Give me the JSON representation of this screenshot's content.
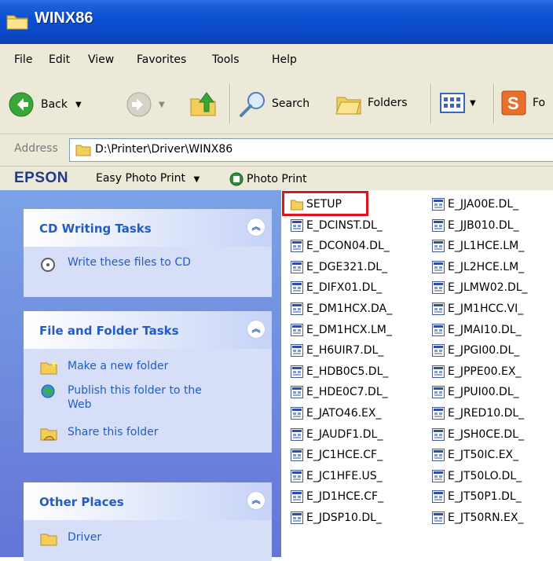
{
  "window": {
    "title": "WINX86"
  },
  "menu": [
    "File",
    "Edit",
    "View",
    "Favorites",
    "Tools",
    "Help"
  ],
  "toolbar": {
    "back_label": "Back",
    "search_label": "Search",
    "folders_label": "Folders",
    "fo_label": "Fo"
  },
  "address": {
    "label": "Address",
    "path": "D:\\Printer\\Driver\\WINX86"
  },
  "epson": {
    "brand": "EPSON",
    "easy_photo_print": "Easy Photo Print",
    "photo_print": "Photo Print"
  },
  "left": {
    "cd_tasks": {
      "title": "CD Writing Tasks",
      "items": [
        "Write these files to CD"
      ]
    },
    "file_tasks": {
      "title": "File and Folder Tasks",
      "items": [
        "Make a new folder",
        "Publish this folder to the Web",
        "Share this folder"
      ]
    },
    "other_places": {
      "title": "Other Places",
      "items": [
        "Driver"
      ]
    }
  },
  "files": {
    "col1": [
      "SETUP",
      "E_DCINST.DL_",
      "E_DCON04.DL_",
      "E_DGE321.DL_",
      "E_DIFX01.DL_",
      "E_DM1HCX.DA_",
      "E_DM1HCX.LM_",
      "E_H6UIR7.DL_",
      "E_HDB0C5.DL_",
      "E_HDE0C7.DL_",
      "E_JATO46.EX_",
      "E_JAUDF1.DL_",
      "E_JC1HCE.CF_",
      "E_JC1HFE.US_",
      "E_JD1HCE.CF_",
      "E_JDSP10.DL_"
    ],
    "col2": [
      "E_JJA00E.DL_",
      "E_JJB010.DL_",
      "E_JL1HCE.LM_",
      "E_JL2HCE.LM_",
      "E_JLMW02.DL_",
      "E_JM1HCC.VI_",
      "E_JMAI10.DL_",
      "E_JPGI00.DL_",
      "E_JPPE00.EX_",
      "E_JPUI00.DL_",
      "E_JRED10.DL_",
      "E_JSH0CE.DL_",
      "E_JT50IC.EX_",
      "E_JT50LO.DL_",
      "E_JT50P1.DL_",
      "E_JT50RN.EX_"
    ]
  },
  "colors": {
    "titlebar": "#0b4fd1",
    "taskpane": "#6f8ddf",
    "link": "#215dc6",
    "highlight": "#e0141e"
  }
}
